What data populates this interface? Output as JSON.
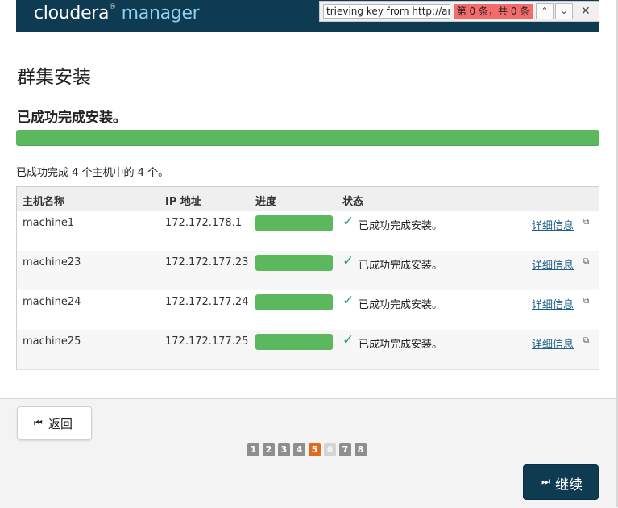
{
  "header": {
    "logo_main": "cloudera",
    "logo_reg": "®",
    "logo_sub": " manager"
  },
  "findbar": {
    "query": "trieving key from http://arc",
    "count": "第 0 条，共 0 条",
    "up_icon": "chevron-up-icon",
    "down_icon": "chevron-down-icon",
    "close_icon": "close-icon",
    "up_glyph": "⌃",
    "down_glyph": "⌄",
    "close_glyph": "✕"
  },
  "page": {
    "title": "群集安装",
    "success_heading": "已成功完成安装。",
    "progress": 1.0,
    "summary": "已成功完成 4 个主机中的 4 个。"
  },
  "table": {
    "headers": [
      "主机名称",
      "IP 地址",
      "进度",
      "状态"
    ],
    "rows": [
      {
        "host": "machine1",
        "ip": "172.172.178.1",
        "progress": 1.0,
        "status": "已成功完成安装。",
        "link": "详细信息"
      },
      {
        "host": "machine23",
        "ip": "172.172.177.23",
        "progress": 1.0,
        "status": "已成功完成安装。",
        "link": "详细信息"
      },
      {
        "host": "machine24",
        "ip": "172.172.177.24",
        "progress": 1.0,
        "status": "已成功完成安装。",
        "link": "详细信息"
      },
      {
        "host": "machine25",
        "ip": "172.172.177.25",
        "progress": 1.0,
        "status": "已成功完成安装。",
        "link": "详细信息"
      }
    ],
    "check_glyph": "✓",
    "ext_glyph": "⧉"
  },
  "footer": {
    "back_label": "返回",
    "back_glyph": "⏮",
    "continue_label": "继续",
    "continue_glyph": "⏭",
    "pages": [
      "1",
      "2",
      "3",
      "4",
      "5",
      "6",
      "7",
      "8"
    ],
    "active_page": "5",
    "disabled_page": "6"
  },
  "colors": {
    "brand": "#0e3a52",
    "success": "#5cb85c",
    "active_step": "#e06b20",
    "link": "#1a5f87"
  }
}
